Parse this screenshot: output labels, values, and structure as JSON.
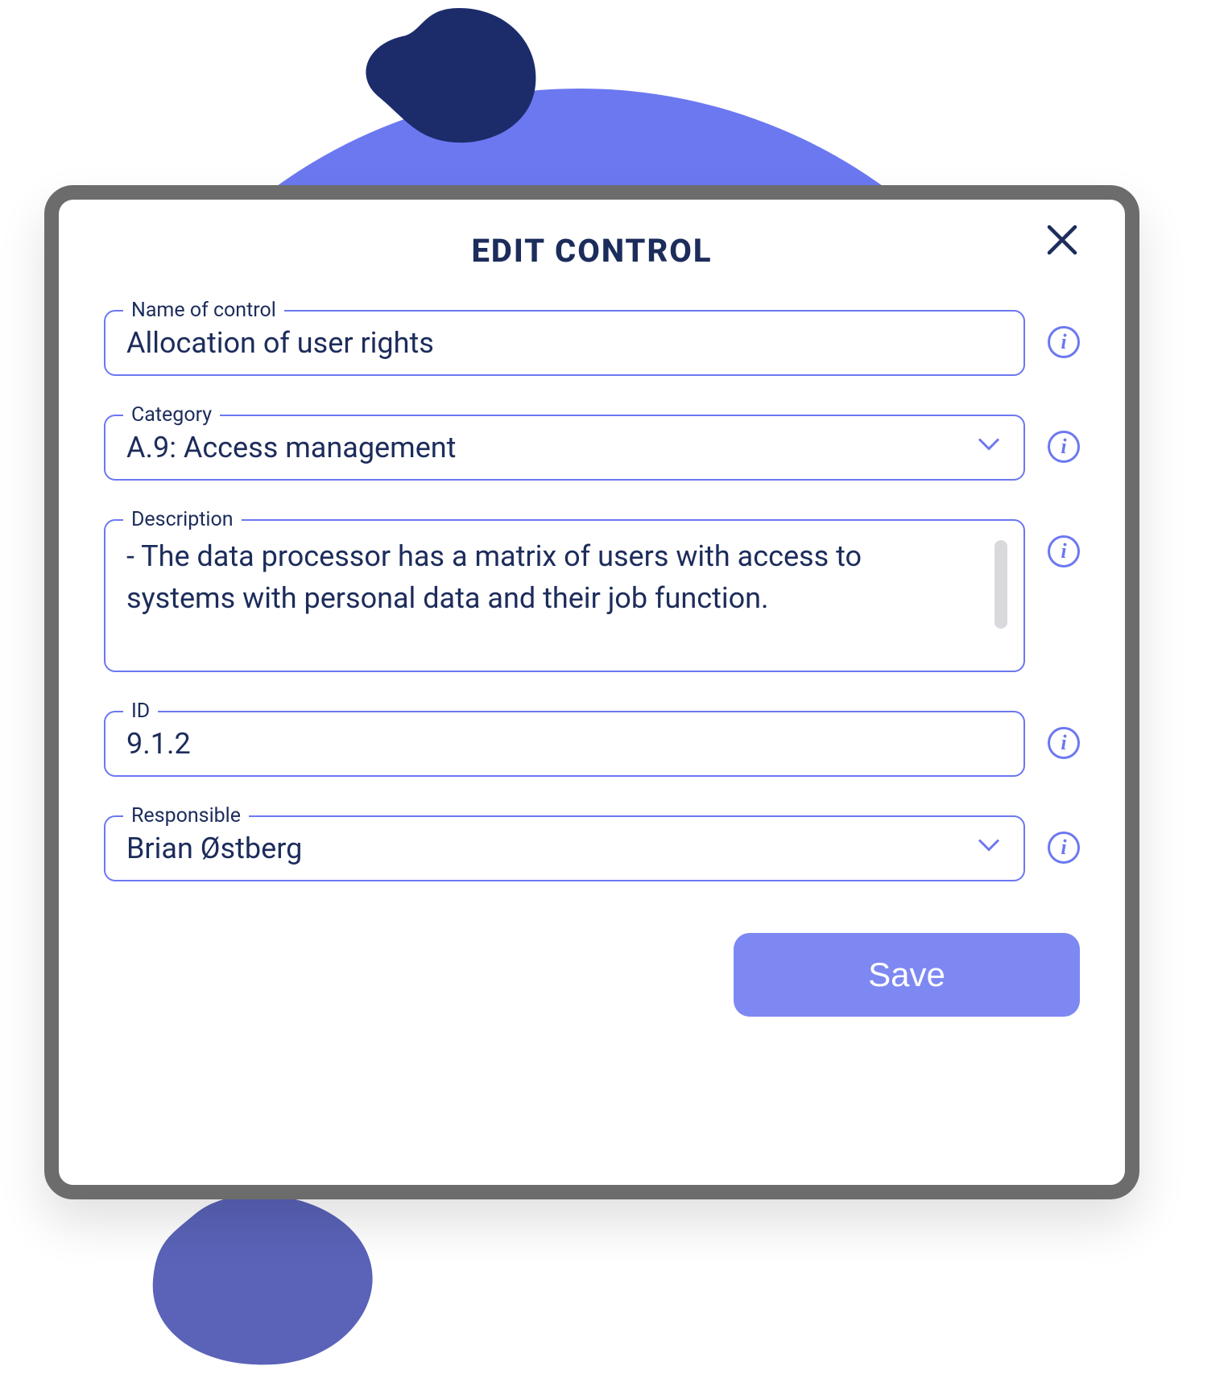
{
  "header": {
    "title": "EDIT CONTROL"
  },
  "fields": {
    "name": {
      "label": "Name of control",
      "value": "Allocation of user rights"
    },
    "category": {
      "label": "Category",
      "value": "A.9: Access management"
    },
    "description": {
      "label": "Description",
      "value": "- The data processor has a matrix of users with access to systems with personal data and their job function."
    },
    "id": {
      "label": "ID",
      "value": "9.1.2"
    },
    "responsible": {
      "label": "Responsible",
      "value": "Brian Østberg"
    }
  },
  "actions": {
    "save_label": "Save"
  },
  "info_glyph": "i"
}
